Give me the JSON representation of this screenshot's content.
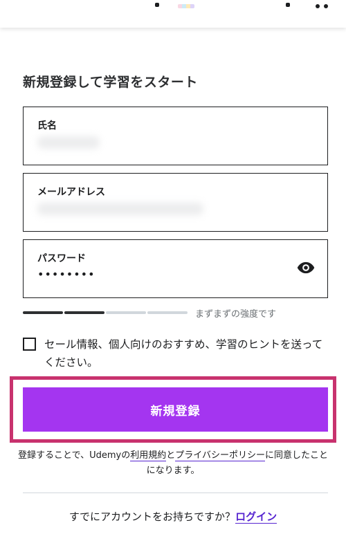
{
  "colors": {
    "accent": "#a435f0",
    "link": "#5624d0",
    "highlight_frame": "#c8326e",
    "strength_filled": "#2d2f31",
    "strength_empty": "#d1d7dc"
  },
  "form": {
    "title": "新規登録して学習をスタート",
    "name_field": {
      "label": "氏名",
      "value": ""
    },
    "email_field": {
      "label": "メールアドレス",
      "value": ""
    },
    "password_field": {
      "label": "パスワード",
      "value": "••••••••",
      "toggle_icon": "eye-icon"
    },
    "strength": {
      "filled_segments": 2,
      "total_segments": 4,
      "text": "まずまずの強度です"
    },
    "checkbox": {
      "checked": false,
      "text": "セール情報、個人向けのおすすめ、学習のヒントを送ってください。"
    },
    "submit_label": "新規登録"
  },
  "terms": {
    "prefix": "登録することで、Udemyの",
    "terms_link": "利用規約",
    "middle": "と",
    "privacy_link": "プライバシーポリシー",
    "suffix": "に同意したことになります。"
  },
  "login": {
    "prompt": "すでにアカウントをお持ちですか？",
    "link_label": "ログイン"
  }
}
